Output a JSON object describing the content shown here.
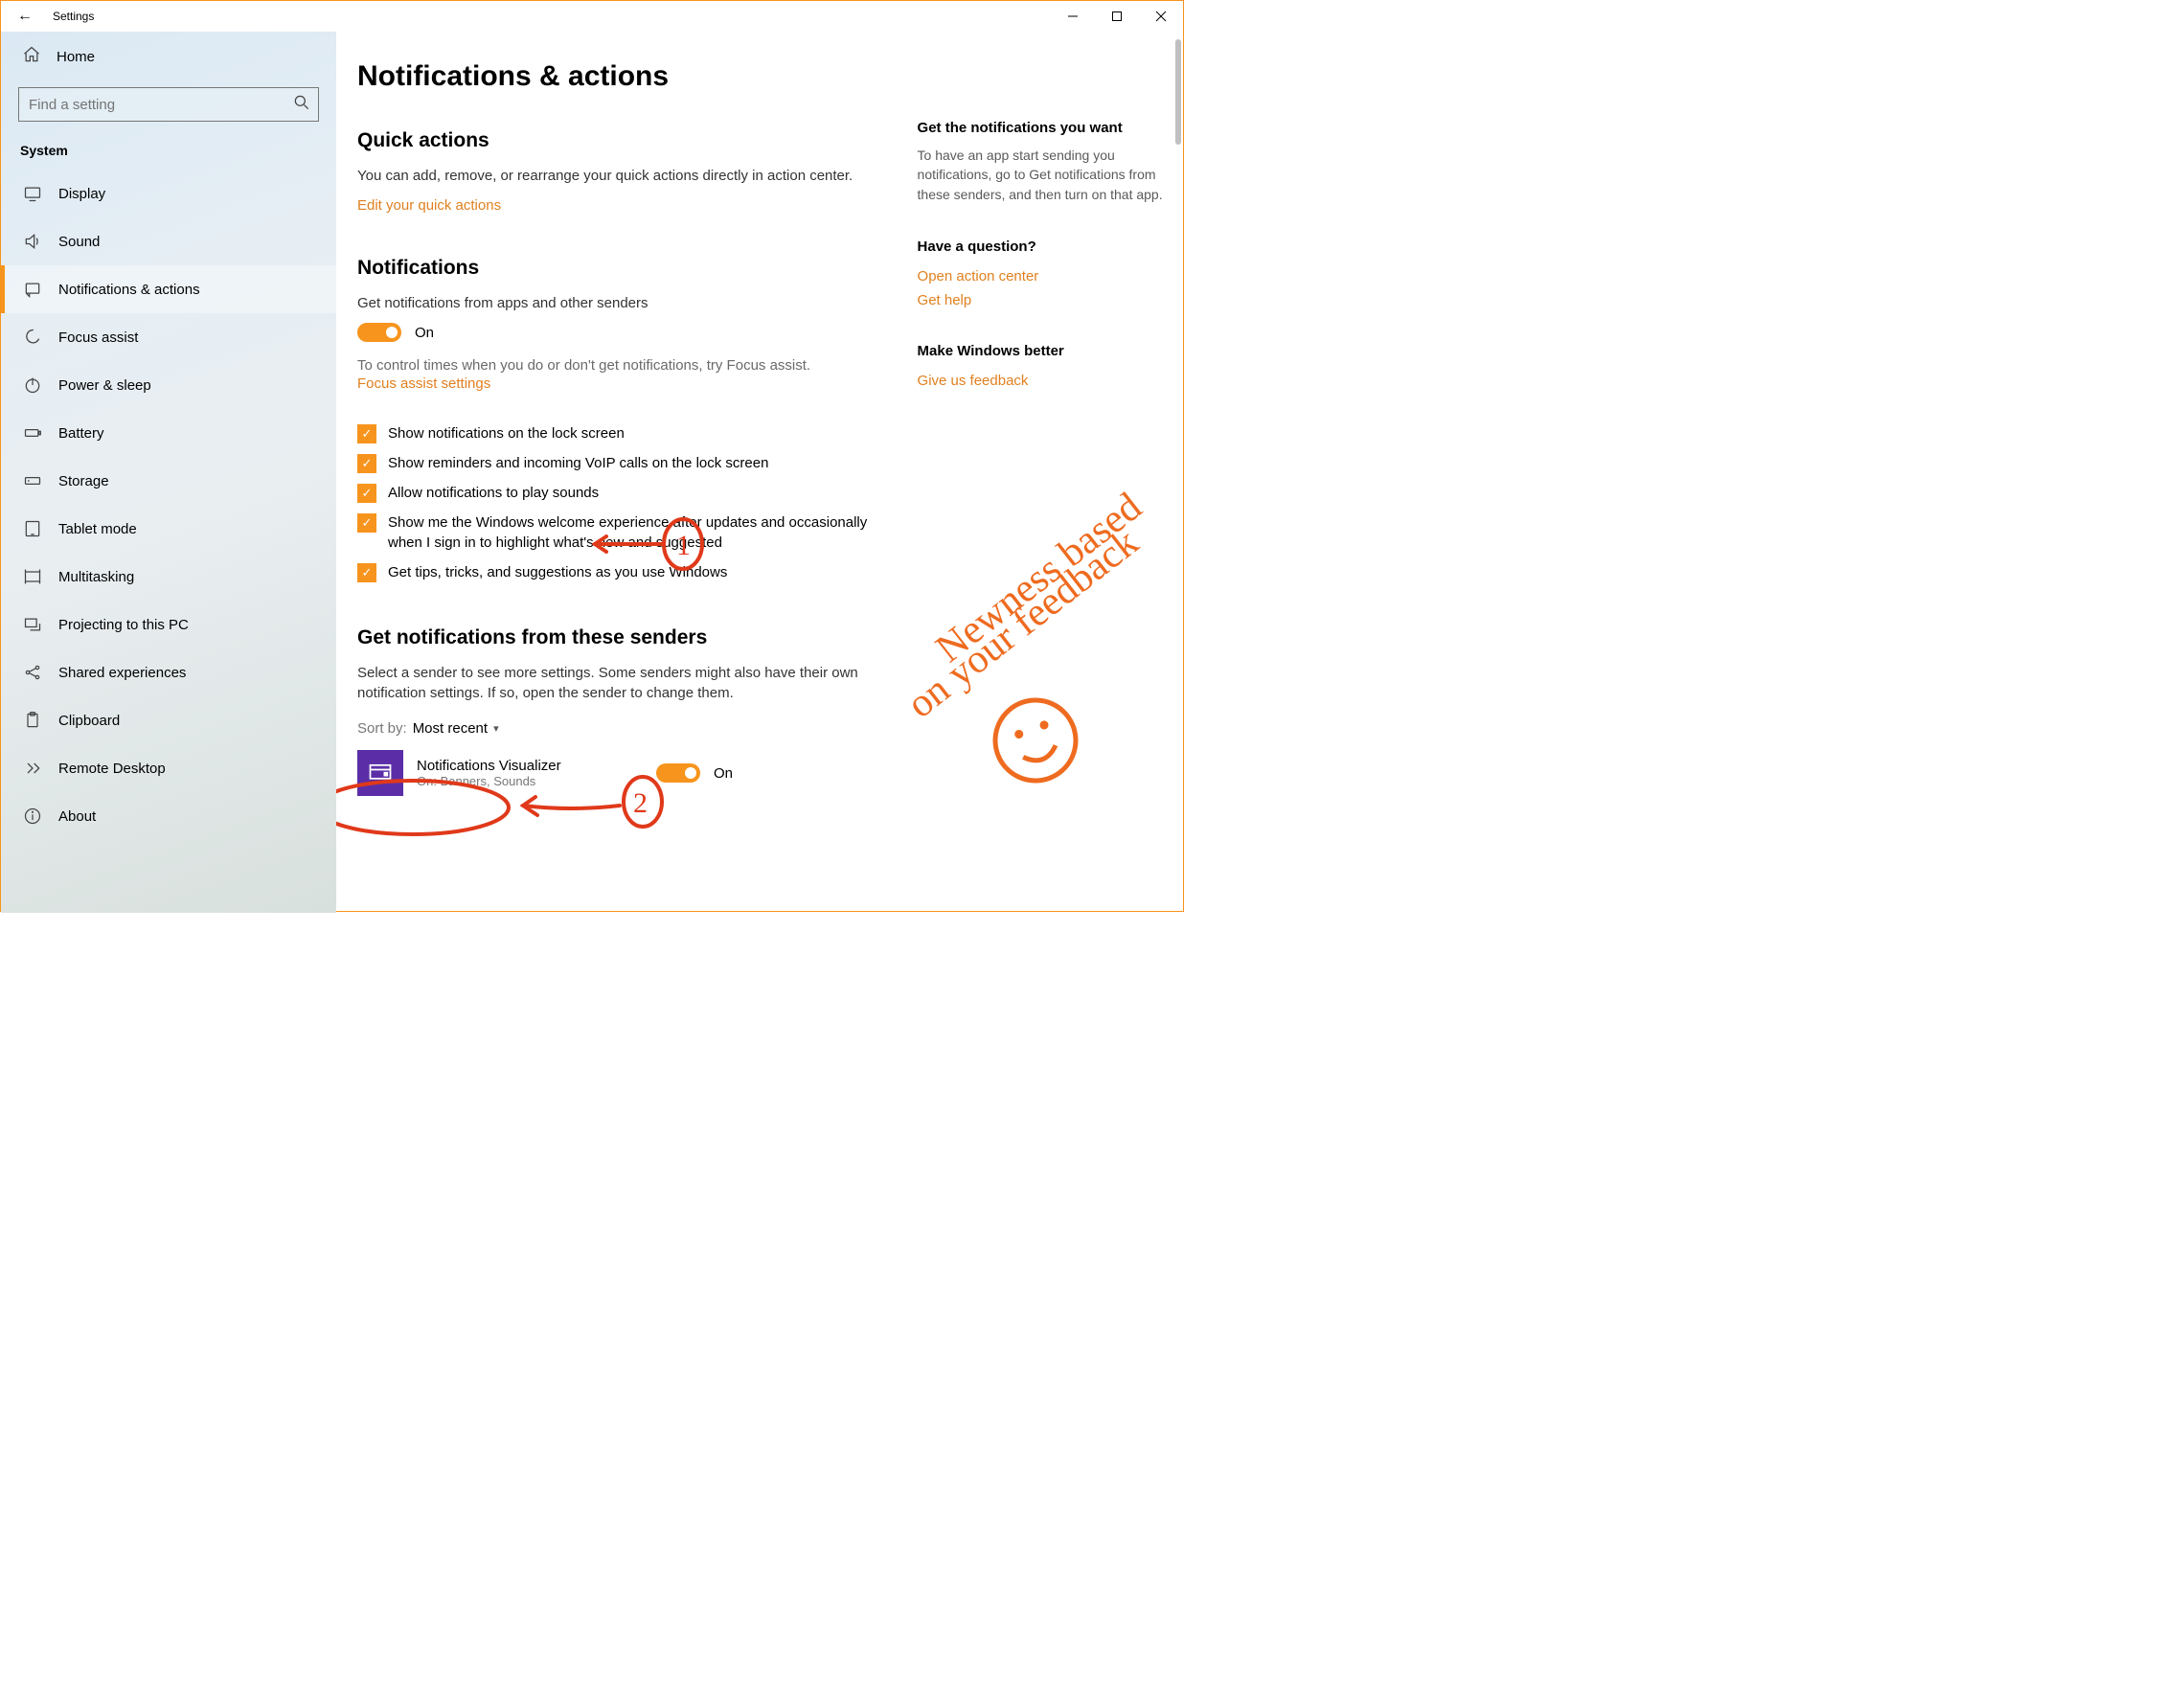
{
  "app": {
    "title": "Settings"
  },
  "sidebar": {
    "home": "Home",
    "search_placeholder": "Find a setting",
    "category": "System",
    "items": [
      {
        "label": "Display"
      },
      {
        "label": "Sound"
      },
      {
        "label": "Notifications & actions"
      },
      {
        "label": "Focus assist"
      },
      {
        "label": "Power & sleep"
      },
      {
        "label": "Battery"
      },
      {
        "label": "Storage"
      },
      {
        "label": "Tablet mode"
      },
      {
        "label": "Multitasking"
      },
      {
        "label": "Projecting to this PC"
      },
      {
        "label": "Shared experiences"
      },
      {
        "label": "Clipboard"
      },
      {
        "label": "Remote Desktop"
      },
      {
        "label": "About"
      }
    ]
  },
  "page": {
    "title": "Notifications & actions",
    "quick_actions": {
      "heading": "Quick actions",
      "body": "You can add, remove, or rearrange your quick actions directly in action center.",
      "link": "Edit your quick actions"
    },
    "notifications": {
      "heading": "Notifications",
      "toggle_label": "Get notifications from apps and other senders",
      "toggle_state": "On",
      "hint": "To control times when you do or don't get notifications, try Focus assist.",
      "focus_link": "Focus assist settings",
      "checks": [
        "Show notifications on the lock screen",
        "Show reminders and incoming VoIP calls on the lock screen",
        "Allow notifications to play sounds",
        "Show me the Windows welcome experience after updates and occasionally when I sign in to highlight what's new and suggested",
        "Get tips, tricks, and suggestions as you use Windows"
      ]
    },
    "senders": {
      "heading": "Get notifications from these senders",
      "body": "Select a sender to see more settings. Some senders might also have their own notification settings. If so, open the sender to change them.",
      "sort_label": "Sort by:",
      "sort_value": "Most recent",
      "list": [
        {
          "name": "Notifications Visualizer",
          "status": "On: Banners, Sounds",
          "toggle": "On"
        }
      ]
    }
  },
  "aside": {
    "wanted": {
      "title": "Get the notifications you want",
      "body": "To have an app start sending you notifications, go to Get notifications from these senders, and then turn on that app."
    },
    "question": {
      "title": "Have a question?",
      "link1": "Open action center",
      "link2": "Get help"
    },
    "better": {
      "title": "Make Windows better",
      "link": "Give us feedback"
    }
  },
  "annotations": {
    "marker1": "1",
    "marker2": "2",
    "handwriting": "Newness based on your feedback"
  }
}
